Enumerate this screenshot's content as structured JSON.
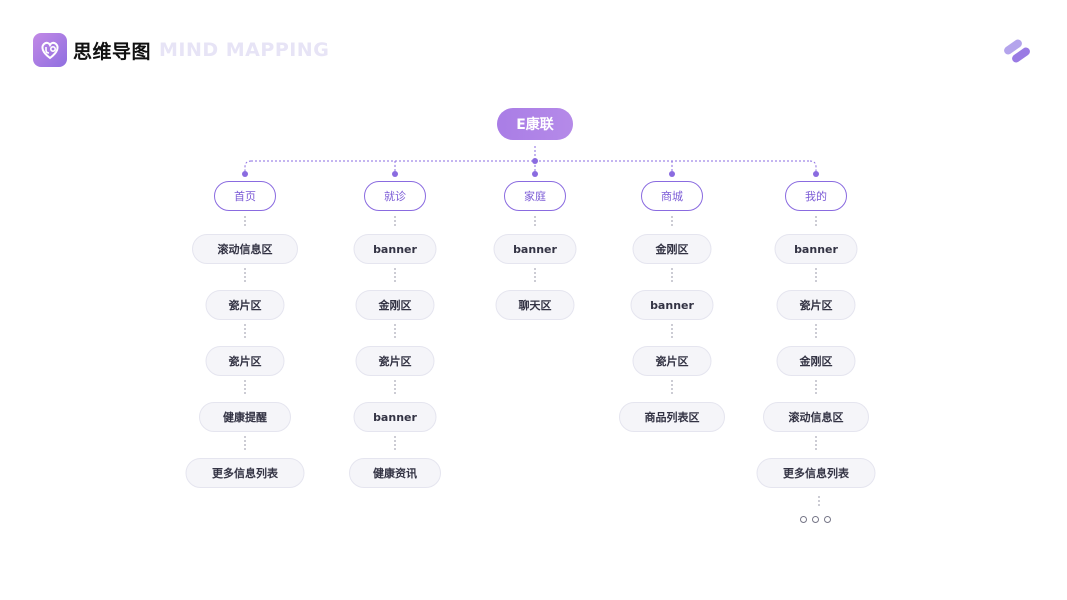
{
  "header": {
    "title_cn": "思维导图",
    "title_en": "MIND MAPPING",
    "logo_icon": "heart-stethoscope-icon",
    "corner_icon": "double-pill-icon"
  },
  "colors": {
    "accent": "#8a6be0",
    "root_gradient": [
      "#a97de6",
      "#b58ae8"
    ],
    "item_bg": "#f5f5f9"
  },
  "diagram": {
    "root": "E康联",
    "columns": [
      {
        "label": "首页",
        "items": [
          "滚动信息区",
          "瓷片区",
          "瓷片区",
          "健康提醒",
          "更多信息列表"
        ]
      },
      {
        "label": "就诊",
        "items": [
          "banner",
          "金刚区",
          "瓷片区",
          "banner",
          "健康资讯"
        ]
      },
      {
        "label": "家庭",
        "items": [
          "banner",
          "聊天区"
        ]
      },
      {
        "label": "商城",
        "items": [
          "金刚区",
          "banner",
          "瓷片区",
          "商品列表区"
        ]
      },
      {
        "label": "我的",
        "items": [
          "banner",
          "瓷片区",
          "金刚区",
          "滚动信息区",
          "更多信息列表"
        ]
      }
    ],
    "more_icon": "ellipsis-circles-icon"
  }
}
